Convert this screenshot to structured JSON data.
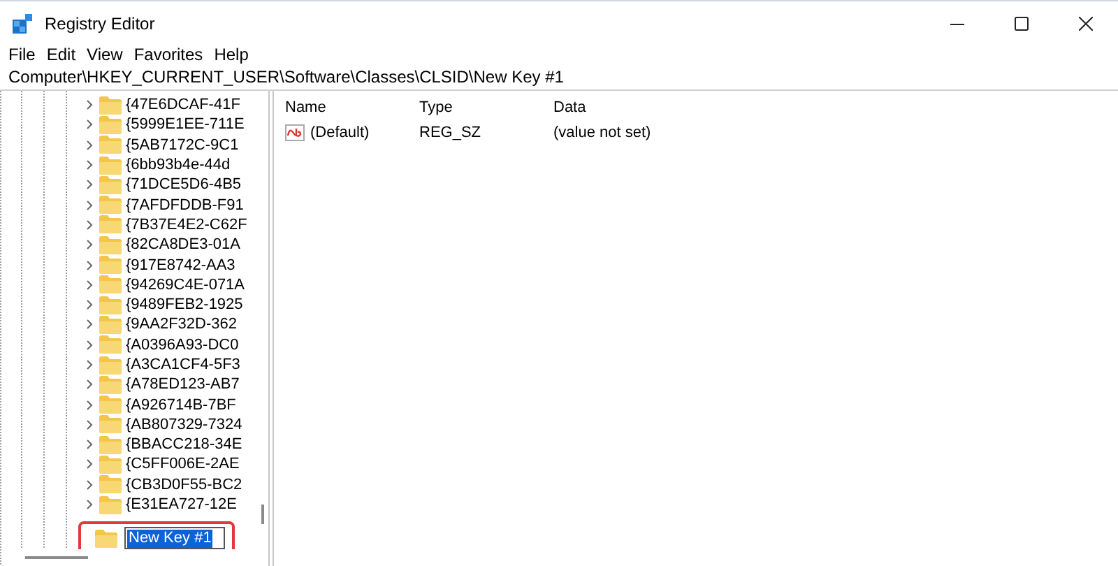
{
  "window": {
    "title": "Registry Editor"
  },
  "menu": [
    "File",
    "Edit",
    "View",
    "Favorites",
    "Help"
  ],
  "address": "Computer\\HKEY_CURRENT_USER\\Software\\Classes\\CLSID\\New Key #1",
  "tree": {
    "keys": [
      {
        "label": "{47E6DCAF-41F",
        "expanded": false
      },
      {
        "label": "{5999E1EE-711E",
        "expanded": false
      },
      {
        "label": "{5AB7172C-9C1",
        "expanded": false
      },
      {
        "label": "{6bb93b4e-44d",
        "expanded": false
      },
      {
        "label": "{71DCE5D6-4B5",
        "expanded": false
      },
      {
        "label": "{7AFDFDDB-F91",
        "expanded": false
      },
      {
        "label": "{7B37E4E2-C62F",
        "expanded": false
      },
      {
        "label": "{82CA8DE3-01A",
        "expanded": false
      },
      {
        "label": "{917E8742-AA3",
        "expanded": false
      },
      {
        "label": "{94269C4E-071A",
        "expanded": false
      },
      {
        "label": "{9489FEB2-1925",
        "expanded": false
      },
      {
        "label": "{9AA2F32D-362",
        "expanded": false
      },
      {
        "label": "{A0396A93-DC0",
        "expanded": false
      },
      {
        "label": "{A3CA1CF4-5F3",
        "expanded": false
      },
      {
        "label": "{A78ED123-AB7",
        "expanded": false
      },
      {
        "label": "{A926714B-7BF",
        "expanded": false
      },
      {
        "label": "{AB807329-7324",
        "expanded": false
      },
      {
        "label": "{BBACC218-34E",
        "expanded": false
      },
      {
        "label": "{C5FF006E-2AE",
        "expanded": false
      },
      {
        "label": "{CB3D0F55-BC2",
        "expanded": false
      },
      {
        "label": "{E31EA727-12E",
        "expanded": false
      }
    ],
    "new_key": {
      "value": "New Key #1"
    }
  },
  "values": {
    "columns": [
      "Name",
      "Type",
      "Data"
    ],
    "rows": [
      {
        "name": "(Default)",
        "type": "REG_SZ",
        "data": "(value not set)"
      }
    ]
  }
}
